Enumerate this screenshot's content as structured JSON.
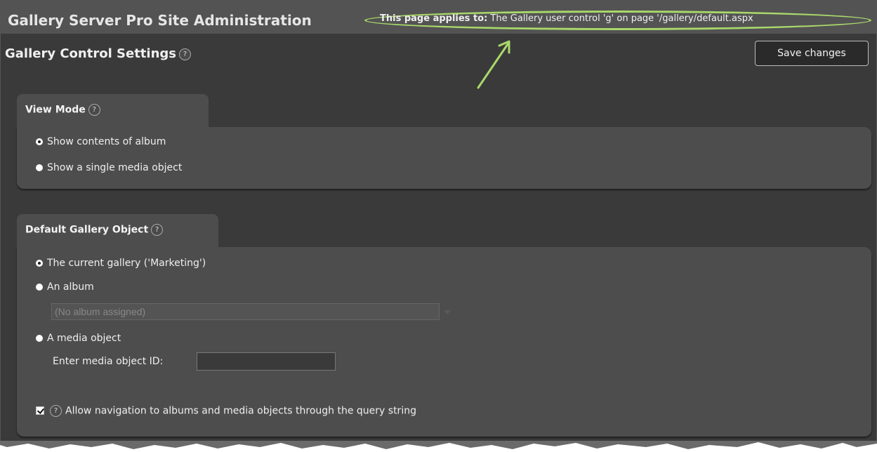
{
  "header": {
    "app_title": "Gallery Server Pro Site Administration",
    "applies_label": "This page applies to:",
    "applies_text": " The Gallery user control 'g' on page '/gallery/default.aspx"
  },
  "page": {
    "title": "Gallery Control Settings",
    "help_glyph": "?",
    "save_label": "Save changes"
  },
  "view_mode": {
    "title": "View Mode",
    "options": [
      {
        "label": "Show contents of album",
        "selected": true
      },
      {
        "label": "Show a single media object",
        "selected": false
      }
    ]
  },
  "default_object": {
    "title": "Default Gallery Object",
    "options": [
      {
        "label": "The current gallery ('Marketing')",
        "selected": true
      },
      {
        "label": "An album",
        "selected": false
      },
      {
        "label": "A media object",
        "selected": false
      }
    ],
    "album_select_value": "(No album assigned)",
    "media_id_label": "Enter media object ID:",
    "media_id_value": "",
    "allow_nav_label": "Allow navigation to albums and media objects through the query string",
    "allow_nav_checked": true
  },
  "colors": {
    "annotation": "#a9d86a",
    "background": "#3a3a3a",
    "panel": "#4d4d4d"
  }
}
